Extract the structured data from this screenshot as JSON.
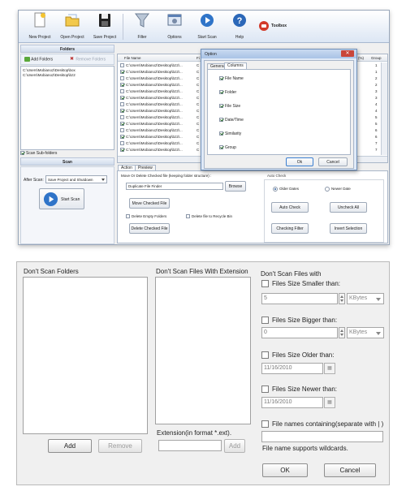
{
  "toolbar": {
    "new_project": "New Project",
    "open_project": "Open Project",
    "save_project": "Save Project",
    "filter": "Filter",
    "options": "Options",
    "start_scan": "Start Scan",
    "help": "Help",
    "toolbox": "Toolbox"
  },
  "folders_panel": {
    "header": "Folders",
    "add_folders": "Add Folders",
    "remove_folders": "Remove Folders",
    "paths": [
      "C:\\Users\\Mobiano2\\Desktop\\box",
      "C:\\Users\\Mobiano2\\Desktop\\bz2"
    ],
    "scan_subfolders": "Scan Sub-folders"
  },
  "scan_panel": {
    "header": "Scan",
    "after_scan_label": "After Scan:",
    "after_scan_value": "Save Project and Shutdown",
    "start_scan": "Start Scan"
  },
  "file_list": {
    "col_file_name": "File Name",
    "col_f": "Fi",
    "col_group": "Group",
    "col_percent": "(%)",
    "rows": [
      {
        "path": "C:\\Users\\Mobiano2\\Desktop\\bz2\\...",
        "flag": "C",
        "checked": false,
        "group": "1"
      },
      {
        "path": "C:\\Users\\Mobiano2\\Desktop\\bz2\\...",
        "flag": "C",
        "checked": true,
        "group": "1"
      },
      {
        "path": "C:\\Users\\Mobiano2\\Desktop\\bz2\\...",
        "flag": "C",
        "checked": false,
        "group": "2"
      },
      {
        "path": "C:\\Users\\Mobiano2\\Desktop\\bz2\\...",
        "flag": "C",
        "checked": true,
        "group": "2"
      },
      {
        "path": "C:\\Users\\Mobiano2\\Desktop\\bz2\\...",
        "flag": "C",
        "checked": false,
        "group": "3"
      },
      {
        "path": "C:\\Users\\Mobiano2\\Desktop\\bz2\\...",
        "flag": "C",
        "checked": true,
        "group": "3"
      },
      {
        "path": "C:\\Users\\Mobiano2\\Desktop\\bz2\\...",
        "flag": "C",
        "checked": false,
        "group": "4"
      },
      {
        "path": "C:\\Users\\Mobiano2\\Desktop\\bz2\\...",
        "flag": "C",
        "checked": true,
        "group": "4"
      },
      {
        "path": "C:\\Users\\Mobiano2\\Desktop\\bz2\\...",
        "flag": "C",
        "checked": false,
        "group": "5"
      },
      {
        "path": "C:\\Users\\Mobiano2\\Desktop\\bz2\\...",
        "flag": "C",
        "checked": true,
        "group": "5"
      },
      {
        "path": "C:\\Users\\Mobiano2\\Desktop\\bz2\\...",
        "flag": "C",
        "checked": false,
        "group": "6"
      },
      {
        "path": "C:\\Users\\Mobiano2\\Desktop\\bz2\\...",
        "flag": "C",
        "checked": true,
        "group": "6"
      },
      {
        "path": "C:\\Users\\Mobiano2\\Desktop\\bz2\\...",
        "flag": "C",
        "checked": false,
        "group": "7"
      },
      {
        "path": "C:\\Users\\Mobiano2\\Desktop\\bz2\\...",
        "flag": "C",
        "checked": true,
        "group": "7"
      }
    ]
  },
  "action_panel": {
    "tab_action": "Action",
    "tab_preview": "Preview",
    "move_or_delete": "Move Or Delete Checked file (keeping folder structure) :",
    "duplicate_finder": "Duplicate File Finder",
    "browse": "Browse",
    "move_checked": "Move Checked File",
    "delete_empty": "Delete Empty Folders",
    "delete_recycle": "Delete file to Recycle Bin",
    "delete_checked": "Delete Checked File",
    "auto_check": "Auto Check",
    "older_dates": "Older Dates",
    "newer_date": "Newer Date",
    "auto_check_btn": "Auto Check",
    "uncheck_all": "Uncheck All",
    "checking_filter": "Checking Filter",
    "invert_selection": "Invert Selection"
  },
  "option_dialog": {
    "title": "Option",
    "tab_general": "General",
    "tab_columns": "Columns",
    "items": [
      "File Name",
      "Folder",
      "File Size",
      "Date/Time",
      "Similarity",
      "Group"
    ],
    "ok": "Ok",
    "cancel": "Cancel"
  },
  "dialog": {
    "dont_scan_folders": "Don't Scan Folders",
    "dont_scan_ext": "Don't Scan Files With Extension",
    "dont_scan_files_with": "Don't Scan Files with",
    "size_smaller": "Files Size Smaller than:",
    "size_smaller_value": "5",
    "size_bigger": "Files Size Bigger than:",
    "size_bigger_value": "0",
    "unit": "KBytes",
    "older_than": "Files Size Older than:",
    "older_value": "11/16/2010",
    "newer_than": "Files Size Newer than:",
    "newer_value": "11/16/2010",
    "name_containing": "File names containing(separate with | )",
    "wildcards": "File name supports wildcards.",
    "ext_format": "Extension(in format *.ext).",
    "add": "Add",
    "remove": "Remove",
    "add_ext": "Add",
    "ok": "OK",
    "cancel": "Cancel"
  },
  "colors": {
    "accent_blue": "#2f74c8",
    "toolbox_red": "#d23a2a",
    "help_blue": "#2b67b8"
  }
}
